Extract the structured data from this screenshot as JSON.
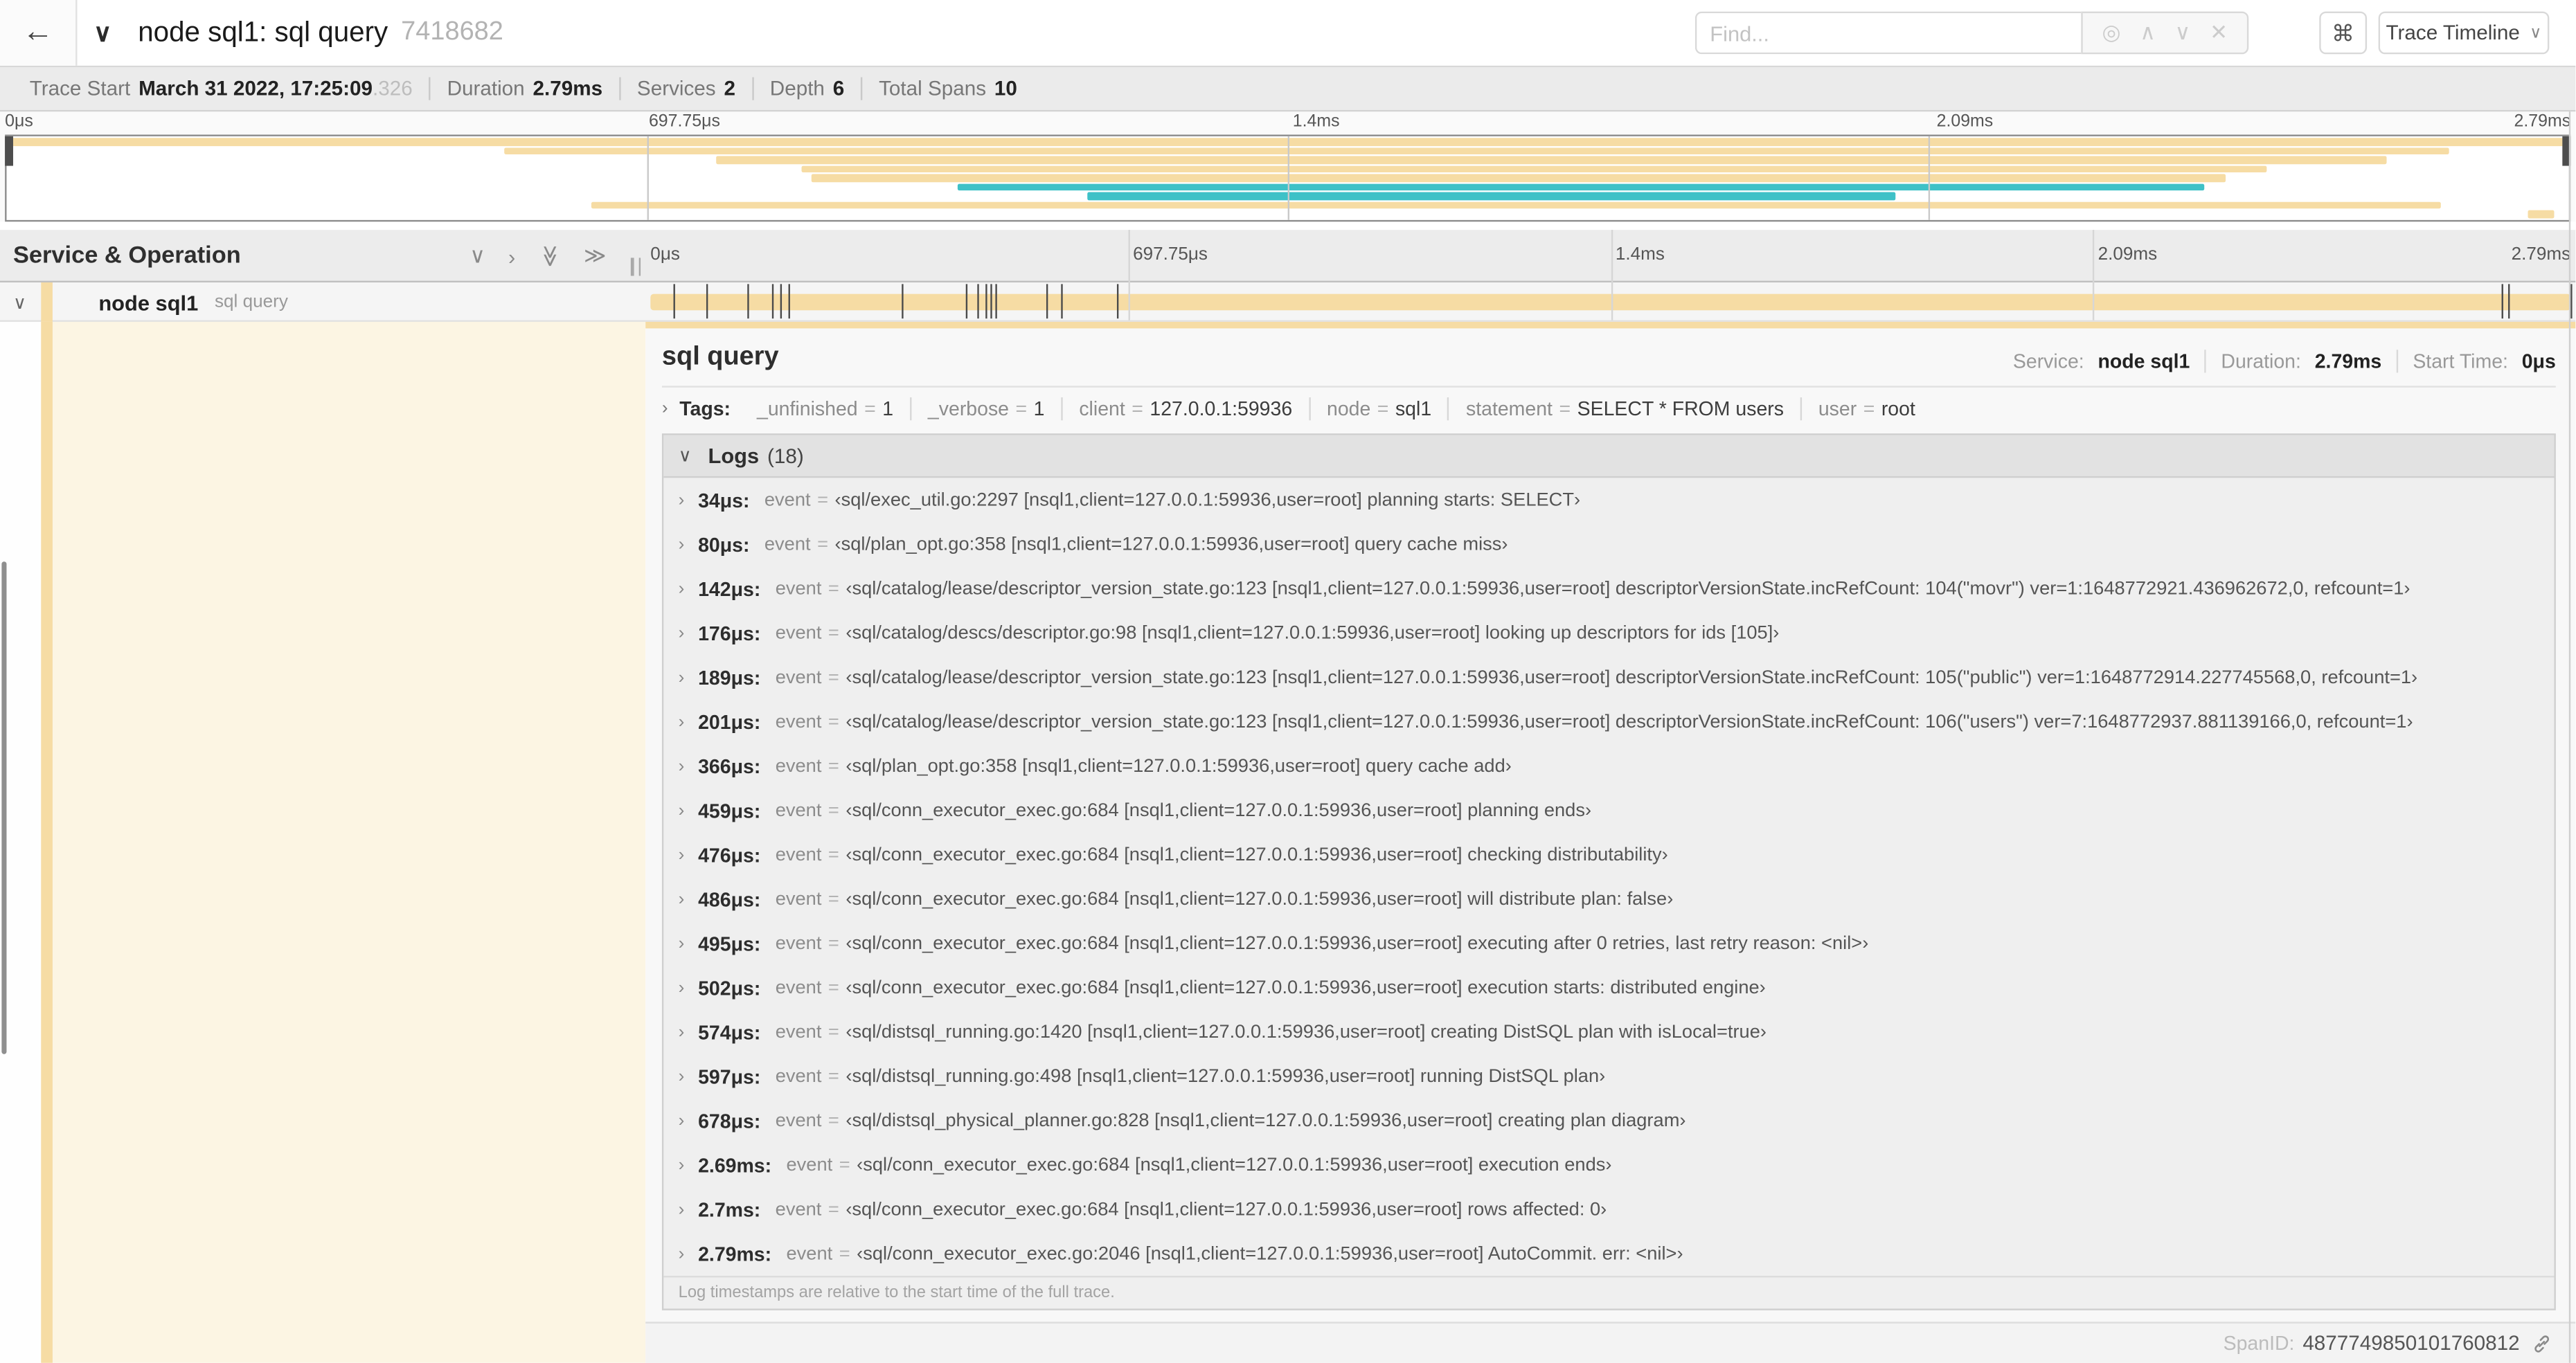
{
  "colors": {
    "span_tan": "#F6DCA4",
    "span_teal": "#3EC1C7",
    "selected_row_bg": "#FCF5E3"
  },
  "icons": {
    "back": "←",
    "chevron_down": "∨",
    "chevron_right": "›",
    "double_chevron_right": "≫",
    "locate": "◎",
    "up": "∧",
    "down": "∨",
    "clear": "✕",
    "command": "⌘",
    "caret": "∨"
  },
  "header": {
    "title": "node sql1: sql query",
    "trace_id": "7418682",
    "find_placeholder": "Find...",
    "view_button": "Trace Timeline"
  },
  "trace_info": {
    "items": [
      {
        "label": "Trace Start",
        "value": "March 31 2022, 17:25:09",
        "suffix": ".326"
      },
      {
        "label": "Duration",
        "value": "2.79ms"
      },
      {
        "label": "Services",
        "value": "2"
      },
      {
        "label": "Depth",
        "value": "6"
      },
      {
        "label": "Total Spans",
        "value": "10"
      }
    ]
  },
  "timeline": {
    "ticks": [
      "0μs",
      "697.75μs",
      "1.4ms",
      "2.09ms",
      "2.79ms"
    ],
    "total_us": 2790
  },
  "minimap": {
    "spans": [
      {
        "start": 0,
        "end": 100,
        "color": "tan"
      },
      {
        "start": 19.4,
        "end": 95.3,
        "color": "tan"
      },
      {
        "start": 27.7,
        "end": 92.9,
        "color": "tan"
      },
      {
        "start": 31.0,
        "end": 88.2,
        "color": "tan"
      },
      {
        "start": 31.4,
        "end": 86.6,
        "color": "tan"
      },
      {
        "start": 37.1,
        "end": 85.8,
        "color": "teal"
      },
      {
        "start": 42.2,
        "end": 73.7,
        "color": "teal"
      },
      {
        "start": 22.8,
        "end": 95.0,
        "color": "tan"
      },
      {
        "start": 98.4,
        "end": 99.4,
        "color": "tan"
      }
    ]
  },
  "left_panel": {
    "header": "Service & Operation"
  },
  "span_row": {
    "service": "node sql1",
    "operation": "sql query"
  },
  "detail": {
    "title": "sql query",
    "meta": [
      {
        "label": "Service:",
        "value": "node sql1"
      },
      {
        "label": "Duration:",
        "value": "2.79ms"
      },
      {
        "label": "Start Time:",
        "value": "0μs"
      }
    ],
    "tags_label": "Tags:",
    "tags": [
      {
        "key": "_unfinished",
        "value": "1"
      },
      {
        "key": "_verbose",
        "value": "1"
      },
      {
        "key": "client",
        "value": "127.0.0.1:59936"
      },
      {
        "key": "node",
        "value": "sql1"
      },
      {
        "key": "statement",
        "value": "SELECT * FROM users"
      },
      {
        "key": "user",
        "value": "root"
      }
    ],
    "logs_label": "Logs",
    "logs_count": "(18)",
    "logs": [
      {
        "time": "34μs:",
        "field": "event",
        "value": "‹sql/exec_util.go:2297 [nsql1,client=127.0.0.1:59936,user=root] planning starts: SELECT›"
      },
      {
        "time": "80μs:",
        "field": "event",
        "value": "‹sql/plan_opt.go:358 [nsql1,client=127.0.0.1:59936,user=root] query cache miss›"
      },
      {
        "time": "142μs:",
        "field": "event",
        "value": "‹sql/catalog/lease/descriptor_version_state.go:123 [nsql1,client=127.0.0.1:59936,user=root] descriptorVersionState.incRefCount: 104(\"movr\") ver=1:1648772921.436962672,0, refcount=1›"
      },
      {
        "time": "176μs:",
        "field": "event",
        "value": "‹sql/catalog/descs/descriptor.go:98 [nsql1,client=127.0.0.1:59936,user=root] looking up descriptors for ids [105]›"
      },
      {
        "time": "189μs:",
        "field": "event",
        "value": "‹sql/catalog/lease/descriptor_version_state.go:123 [nsql1,client=127.0.0.1:59936,user=root] descriptorVersionState.incRefCount: 105(\"public\") ver=1:1648772914.227745568,0, refcount=1›"
      },
      {
        "time": "201μs:",
        "field": "event",
        "value": "‹sql/catalog/lease/descriptor_version_state.go:123 [nsql1,client=127.0.0.1:59936,user=root] descriptorVersionState.incRefCount: 106(\"users\") ver=7:1648772937.881139166,0, refcount=1›"
      },
      {
        "time": "366μs:",
        "field": "event",
        "value": "‹sql/plan_opt.go:358 [nsql1,client=127.0.0.1:59936,user=root] query cache add›"
      },
      {
        "time": "459μs:",
        "field": "event",
        "value": "‹sql/conn_executor_exec.go:684 [nsql1,client=127.0.0.1:59936,user=root] planning ends›"
      },
      {
        "time": "476μs:",
        "field": "event",
        "value": "‹sql/conn_executor_exec.go:684 [nsql1,client=127.0.0.1:59936,user=root] checking distributability›"
      },
      {
        "time": "486μs:",
        "field": "event",
        "value": "‹sql/conn_executor_exec.go:684 [nsql1,client=127.0.0.1:59936,user=root] will distribute plan: false›"
      },
      {
        "time": "495μs:",
        "field": "event",
        "value": "‹sql/conn_executor_exec.go:684 [nsql1,client=127.0.0.1:59936,user=root] executing after 0 retries, last retry reason: <nil>›"
      },
      {
        "time": "502μs:",
        "field": "event",
        "value": "‹sql/conn_executor_exec.go:684 [nsql1,client=127.0.0.1:59936,user=root] execution starts: distributed engine›"
      },
      {
        "time": "574μs:",
        "field": "event",
        "value": "‹sql/distsql_running.go:1420 [nsql1,client=127.0.0.1:59936,user=root] creating DistSQL plan with isLocal=true›"
      },
      {
        "time": "597μs:",
        "field": "event",
        "value": "‹sql/distsql_running.go:498 [nsql1,client=127.0.0.1:59936,user=root] running DistSQL plan›"
      },
      {
        "time": "678μs:",
        "field": "event",
        "value": "‹sql/distsql_physical_planner.go:828 [nsql1,client=127.0.0.1:59936,user=root] creating plan diagram›"
      },
      {
        "time": "2.69ms:",
        "field": "event",
        "value": "‹sql/conn_executor_exec.go:684 [nsql1,client=127.0.0.1:59936,user=root] execution ends›"
      },
      {
        "time": "2.7ms:",
        "field": "event",
        "value": "‹sql/conn_executor_exec.go:684 [nsql1,client=127.0.0.1:59936,user=root] rows affected: 0›"
      },
      {
        "time": "2.79ms:",
        "field": "event",
        "value": "‹sql/conn_executor_exec.go:2046 [nsql1,client=127.0.0.1:59936,user=root] AutoCommit. err: <nil>›"
      }
    ],
    "footnote": "Log timestamps are relative to the start time of the full trace.",
    "span_id_label": "SpanID:",
    "span_id": "4877749850101760812"
  }
}
